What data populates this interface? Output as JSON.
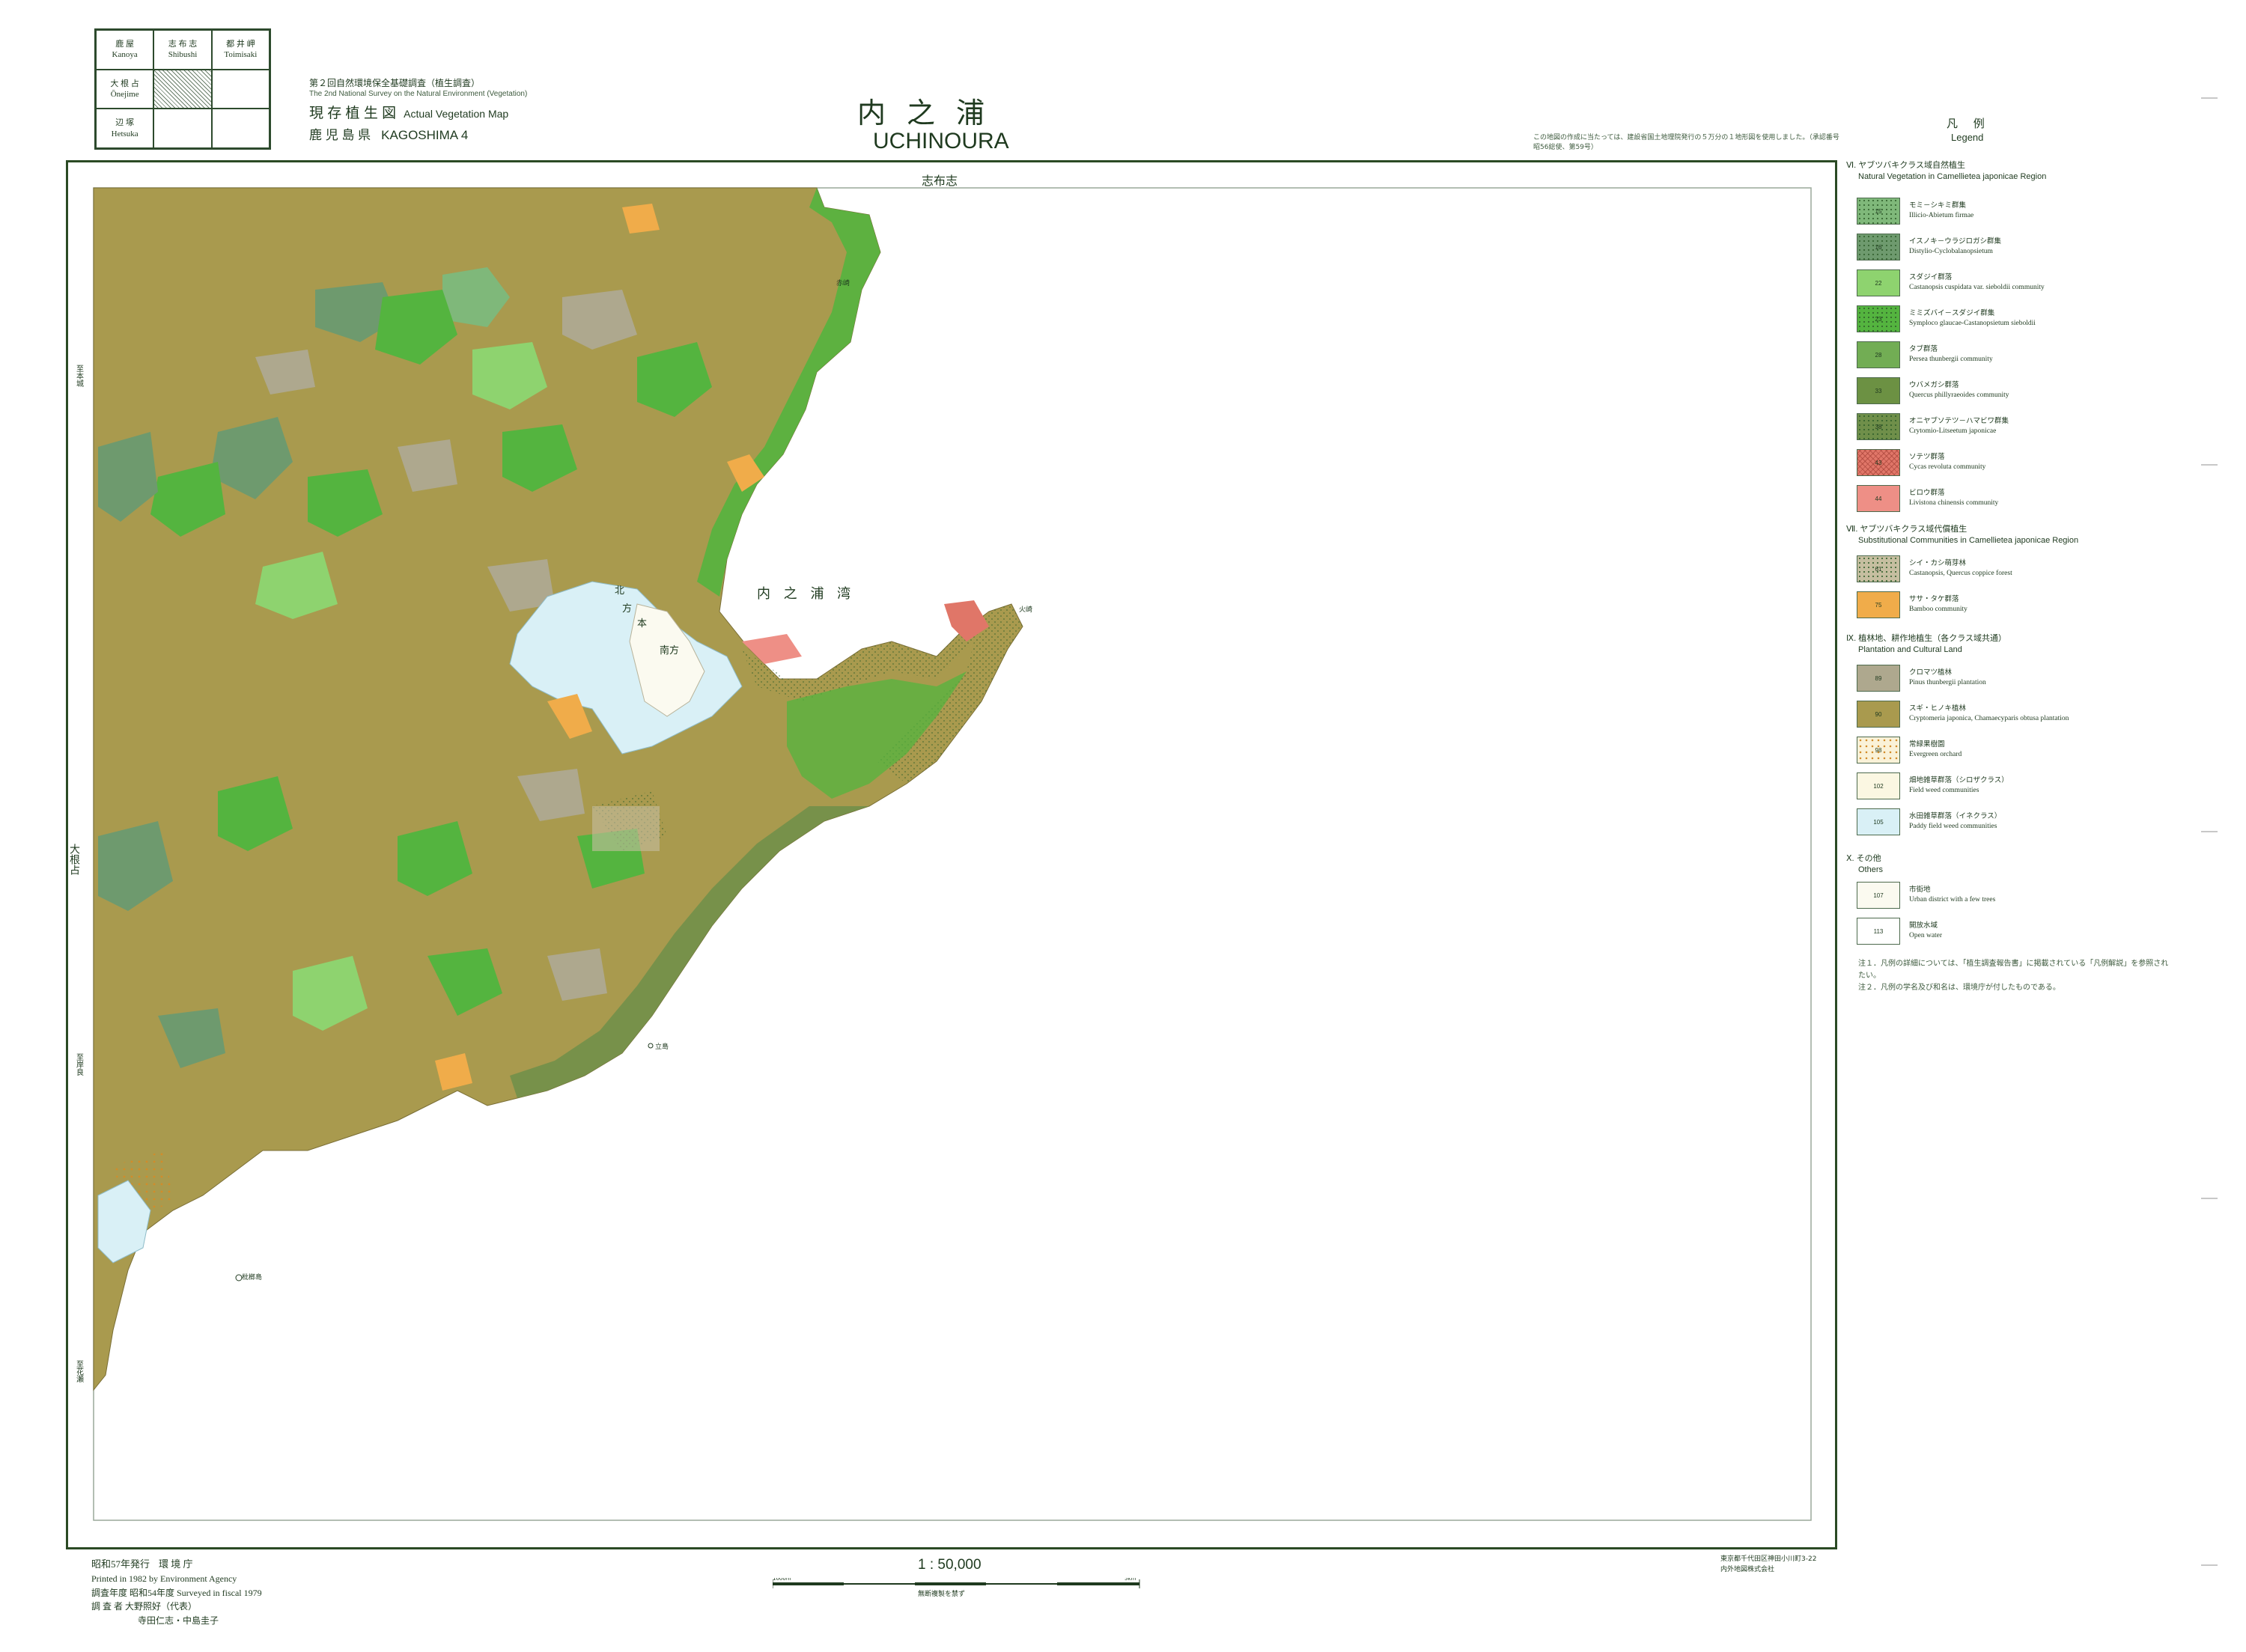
{
  "index_grid": [
    {
      "jp": "鹿 屋",
      "en": "Kanoya"
    },
    {
      "jp": "志 布 志",
      "en": "Shibushi"
    },
    {
      "jp": "都 井 岬",
      "en": "Toimisaki"
    },
    {
      "jp": "大 根 占",
      "en": "Ōnejime"
    },
    {
      "jp": "",
      "en": ""
    },
    {
      "jp": "",
      "en": ""
    },
    {
      "jp": "辺 塚",
      "en": "Hetsuka"
    },
    {
      "jp": "",
      "en": ""
    },
    {
      "jp": "",
      "en": ""
    }
  ],
  "survey": {
    "jp": "第２回自然環境保全基礎調査（植生調査）",
    "en": "The 2nd National Survey on the Natural Environment (Vegetation)",
    "type_jp": "現 存 植 生 図",
    "type_en": "Actual Vegetation Map",
    "pref_jp": "鹿 児 島 県",
    "pref_en": "KAGOSHIMA  4"
  },
  "title": {
    "jp": "内之浦",
    "en": "UCHINOURA"
  },
  "copyright_note": "この地図の作成に当たっては、建設省国土地理院発行の５万分の１地形図を使用しました。（承認番号 昭56総使、第59号）",
  "map_labels": {
    "top_neighbor": "志布志",
    "bay": "内 之 浦 湾",
    "town_kita": "北",
    "town_kata": "方",
    "town_moto": "本",
    "town_minami": "南方",
    "left_neighbor": "大根占",
    "left_v1": "至本城",
    "left_v2": "至岸良",
    "left_v3": "至花瀬",
    "island1": "枇榔島",
    "island2": "立島",
    "cape": "火崎",
    "cape2": "赤崎"
  },
  "legend": {
    "title_jp": "凡 例",
    "title_en": "Legend",
    "sections": [
      {
        "jp": "Ⅵ. ヤブツバキクラス域自然植生",
        "en": "Natural Vegetation in Camellietea japonicae Region",
        "items": [
          {
            "code": "15",
            "jp": "モミ－シキミ群集",
            "en": "Illicio-Abietum firmae",
            "color": "#7fb87a",
            "pattern": "dot"
          },
          {
            "code": "16",
            "jp": "イスノキ－ウラジロガシ群集",
            "en": "Distylio-Cyclobalanopsietum",
            "color": "#6e9a6e",
            "pattern": "dot"
          },
          {
            "code": "22",
            "jp": "スダジイ群落",
            "en": "Castanopsis cuspidata var. sieboldii community",
            "color": "#8ed36f",
            "pattern": "none"
          },
          {
            "code": "23",
            "jp": "ミミズバイ－スダジイ群集",
            "en": "Symploco glaucae-Castanopsietum sieboldii",
            "color": "#54b43f",
            "pattern": "dot"
          },
          {
            "code": "28",
            "jp": "タブ群落",
            "en": "Persea thunbergii community",
            "color": "#72ad54",
            "pattern": "none"
          },
          {
            "code": "33",
            "jp": "ウバメガシ群落",
            "en": "Quercus phillyraeoides community",
            "color": "#6c9143",
            "pattern": "none"
          },
          {
            "code": "38",
            "jp": "オニヤブソテツ－ハマビワ群集",
            "en": "Crytomio-Litseetum japonicae",
            "color": "#6f8f4a",
            "pattern": "dot"
          },
          {
            "code": "43",
            "jp": "ソテツ群落",
            "en": "Cycas revoluta community",
            "color": "#e07668",
            "pattern": "cross"
          },
          {
            "code": "44",
            "jp": "ビロウ群落",
            "en": "Livistona chinensis community",
            "color": "#ee8f86",
            "pattern": "none"
          }
        ]
      },
      {
        "jp": "Ⅶ. ヤブツバキクラス域代償植生",
        "en": "Substitutional Communities in Camellietea japonicae Region",
        "items": [
          {
            "code": "61",
            "jp": "シイ・カシ萌芽林",
            "en": "Castanopsis, Quercus coppice forest",
            "color": "#c6bea0",
            "pattern": "dot"
          },
          {
            "code": "75",
            "jp": "ササ・タケ群落",
            "en": "Bamboo community",
            "color": "#f0ac4a",
            "pattern": "none"
          }
        ]
      },
      {
        "jp": "Ⅸ. 植林地、耕作地植生（各クラス域共通）",
        "en": "Plantation and Cultural Land",
        "items": [
          {
            "code": "89",
            "jp": "クロマツ植林",
            "en": "Pinus thunbergii plantation",
            "color": "#aea88e",
            "pattern": "none"
          },
          {
            "code": "90",
            "jp": "スギ・ヒノキ植林",
            "en": "Cryptomeria japonica, Chamaecyparis obtusa plantation",
            "color": "#a99a4e",
            "pattern": "none"
          },
          {
            "code": "98",
            "jp": "常緑果樹園",
            "en": "Evergreen orchard",
            "color": "#faf2d8",
            "pattern": "orchard"
          },
          {
            "code": "102",
            "jp": "畑地雑草群落（シロザクラス）",
            "en": "Field weed communities",
            "color": "#fbf7e2",
            "pattern": "none"
          },
          {
            "code": "105",
            "jp": "水田雑草群落（イネクラス）",
            "en": "Paddy field weed communities",
            "color": "#d9f0f6",
            "pattern": "none"
          }
        ]
      },
      {
        "jp": "Ⅹ. その他",
        "en": "Others",
        "items": [
          {
            "code": "107",
            "jp": "市街地",
            "en": "Urban district with a few trees",
            "color": "#fbfaf0",
            "pattern": "none"
          },
          {
            "code": "113",
            "jp": "開放水域",
            "en": "Open water",
            "color": "#ffffff",
            "pattern": "none"
          }
        ]
      }
    ],
    "notes": [
      "注１．凡例の詳細については、「植生調査報告書」に掲載されている「凡例解説」を参照されたい。",
      "注２．凡例の学名及び和名は、環境庁が付したものである。"
    ]
  },
  "footer": {
    "published_jp": "昭和57年発行",
    "agency_jp": "環 境 庁",
    "printed_en": "Printed in 1982 by Environment Agency",
    "survey_year": "調査年度  昭和54年度  Surveyed in fiscal 1979",
    "surveyor": "調 査 者  大野照好（代表）",
    "surveyor2": "寺田仁志・中島圭子",
    "scale": "1 : 50,000",
    "scale_note": "無断複製を禁ず",
    "scale_left": "1000m",
    "scale_right": "5km",
    "printer1": "東京都千代田区神田小川町3-22",
    "printer2": "内外地図株式会社"
  }
}
